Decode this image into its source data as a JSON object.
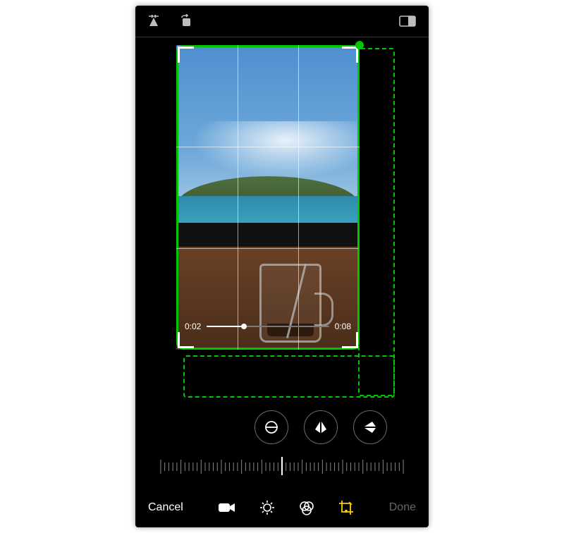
{
  "topbar": {
    "flip_perspective_icon": "flip-perspective",
    "rotate_icon": "rotate-ccw",
    "aspect_icon": "aspect-ratio"
  },
  "scrubber": {
    "current": "0:02",
    "total": "0:08",
    "progress_pct": 28
  },
  "transform_buttons": {
    "straighten": "straighten",
    "flip_h": "flip-horizontal",
    "flip_v": "flip-vertical"
  },
  "bottombar": {
    "cancel": "Cancel",
    "done": "Done",
    "tools": {
      "video": "video",
      "adjust": "adjust",
      "filters": "filters",
      "crop": "crop"
    },
    "active_tool": "crop"
  },
  "highlight": {
    "color": "#00c800"
  }
}
